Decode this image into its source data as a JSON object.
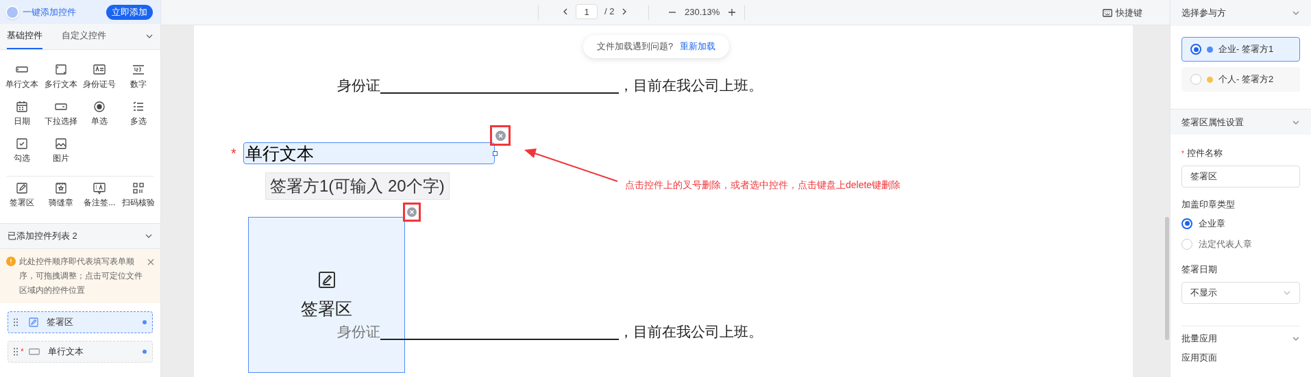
{
  "left_panel": {
    "ai_title": "一键添加控件",
    "ai_button": "立即添加",
    "tabs": [
      {
        "label": "基础控件",
        "selected": true
      },
      {
        "label": "自定义控件",
        "selected": false
      }
    ],
    "basic_controls": [
      {
        "label": "单行文本"
      },
      {
        "label": "多行文本"
      },
      {
        "label": "身份证号"
      },
      {
        "label": "数字"
      },
      {
        "label": "日期"
      },
      {
        "label": "下拉选择"
      },
      {
        "label": "单选"
      },
      {
        "label": "多选"
      },
      {
        "label": "勾选"
      },
      {
        "label": "图片"
      }
    ],
    "sign_controls": [
      {
        "label": "签署区"
      },
      {
        "label": "骑缝章"
      },
      {
        "label": "备注签..."
      },
      {
        "label": "扫码核验"
      }
    ],
    "added_list": {
      "title": "已添加控件列表 2",
      "notice": "此处控件顺序即代表填写表单顺序，可拖拽调整；点击可定位文件区域内的控件位置",
      "items": [
        {
          "label": "签署区",
          "selected": true
        },
        {
          "label": "单行文本",
          "mark": "*",
          "selected": false
        }
      ]
    }
  },
  "toolbar": {
    "page": "1",
    "total": "/ 2",
    "zoom": "230.13%",
    "shortcut": "快捷键"
  },
  "document": {
    "notice": {
      "text": "文件加载遇到问题?",
      "link": "重新加载"
    },
    "lines": [
      {
        "before": "身份证",
        "after": "，目前在我公司上班。"
      },
      {
        "before": "身份证",
        "after": "，目前在我公司上班。"
      }
    ],
    "text_field": {
      "mark": "*",
      "label": "单行文本",
      "selected": true
    },
    "caption": "签署方1(可输入 20个字)",
    "sign_area": {
      "label": "签署区",
      "selected": true
    },
    "annotation": "点击控件上的叉号删除，或者选中控件，点击键盘上delete键删除"
  },
  "right_panel": {
    "participants_title": "选择参与方",
    "participants": [
      {
        "label": "企业- 签署方1",
        "selected": true,
        "color": "#4e8cf7"
      },
      {
        "label": "个人- 签署方2",
        "selected": false,
        "color": "#f9c14c"
      }
    ],
    "properties_title": "签署区属性设置",
    "name_field": {
      "mark": "*",
      "label": "控件名称",
      "value": "签署区"
    },
    "seal_type": {
      "label": "加盖印章类型",
      "options": [
        {
          "label": "企业章",
          "selected": true
        },
        {
          "label": "法定代表人章",
          "selected": false
        }
      ]
    },
    "sign_date": {
      "label": "签署日期",
      "value": "不显示"
    },
    "batch": {
      "title": "批量应用",
      "label": "应用页面"
    }
  }
}
